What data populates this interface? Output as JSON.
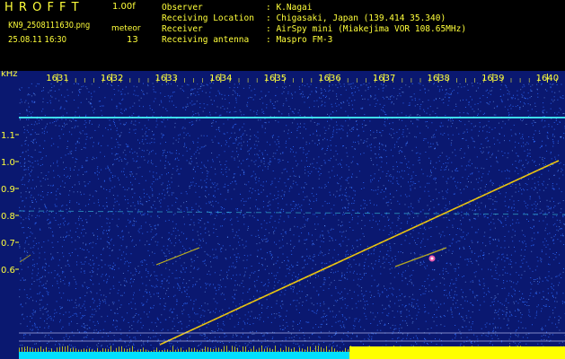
{
  "header": {
    "program_name": "H R O F F T",
    "version": "1.00f",
    "file_name": "KN9_2508111630.png",
    "date_time": "25.08.11 16:30",
    "meteor_label": "meteor",
    "meteor_count": "13",
    "info_lines": [
      {
        "label": "Observer",
        "value": ": K.Nagai"
      },
      {
        "label": "Receiving Location",
        "value": ": Chigasaki, Japan (139.414 35.340)"
      },
      {
        "label": "Receiver",
        "value": ": AirSpy mini (Miakejima VOR 108.65MHz)"
      },
      {
        "label": "Receiving antenna",
        "value": ": Maspro FM-3"
      }
    ]
  },
  "spectrogram": {
    "freq_unit": "kHz",
    "freq_ticks": [
      "1.1",
      "1.0",
      "0.9",
      "0.8",
      "0.7",
      "0.6"
    ],
    "time_ticks": [
      "1631",
      "1632",
      "1633",
      "1634",
      "1635",
      "1636",
      "1637",
      "1638",
      "1639",
      "1640"
    ],
    "colors": {
      "text": "#ffff3a",
      "background": "#0a1870",
      "noise": "#2e6cff",
      "signal": "#ffe600",
      "carrier": "#48ffff",
      "receive_band": "#00e0ff",
      "level_band": "#ffff00",
      "meteor": "#ff5fb4"
    }
  }
}
